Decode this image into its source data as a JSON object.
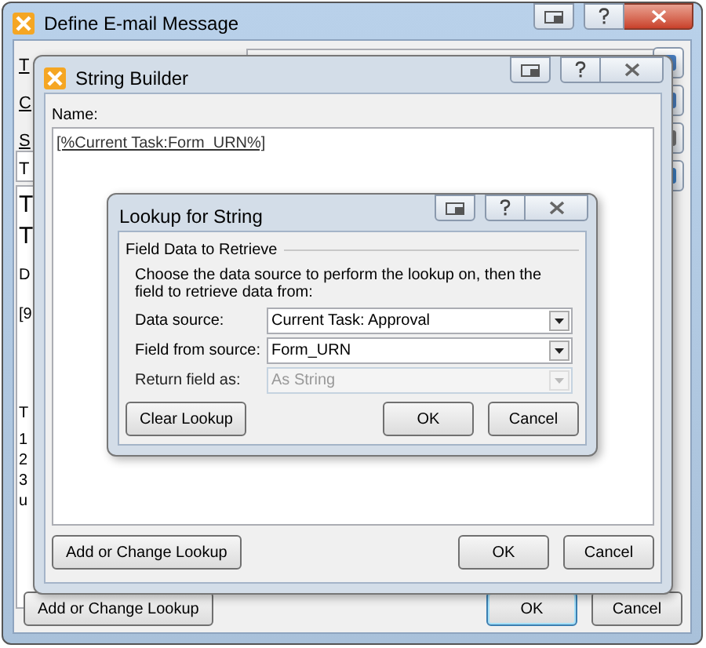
{
  "main_window": {
    "title": "Define E-mail Message",
    "active_close": true,
    "field_labels": [
      "T",
      "C",
      "S"
    ],
    "field_stub": "T",
    "body_fragments": [
      {
        "text": "T",
        "kind": "heading"
      },
      {
        "text": "T",
        "kind": "heading"
      },
      {
        "text": "D",
        "kind": "text"
      },
      {
        "text": "[9",
        "kind": "text"
      },
      {
        "text": "T",
        "kind": "text"
      },
      {
        "text": "1",
        "kind": "text"
      },
      {
        "text": "2",
        "kind": "text"
      },
      {
        "text": "3",
        "kind": "text"
      },
      {
        "text": "u",
        "kind": "text"
      }
    ],
    "buttons": [
      {
        "label": "Add or Change Lookup",
        "kind": "left",
        "default": false
      },
      {
        "label": "OK",
        "kind": "right",
        "default": true
      },
      {
        "label": "Cancel",
        "kind": "right",
        "default": false
      }
    ]
  },
  "string_builder": {
    "title": "String Builder",
    "name_label": "Name:",
    "name_value": "[%Current Task:Form_URN%]",
    "buttons": [
      {
        "label": "Add or Change Lookup",
        "kind": "left"
      },
      {
        "label": "OK",
        "kind": "right"
      },
      {
        "label": "Cancel",
        "kind": "right"
      }
    ]
  },
  "lookup": {
    "title": "Lookup for String",
    "group_title": "Field Data to Retrieve",
    "instructions": "Choose the data source to perform the lookup on, then the field to retrieve data from:",
    "rows": [
      {
        "label": "Data source:",
        "value": "Current Task: Approval",
        "disabled": false
      },
      {
        "label": "Field from source:",
        "value": "Form_URN",
        "disabled": false
      },
      {
        "label": "Return field as:",
        "value": "As String",
        "disabled": true
      }
    ],
    "buttons": [
      {
        "label": "Clear Lookup",
        "kind": "left"
      },
      {
        "label": "OK",
        "kind": "right"
      },
      {
        "label": "Cancel",
        "kind": "right"
      }
    ]
  }
}
